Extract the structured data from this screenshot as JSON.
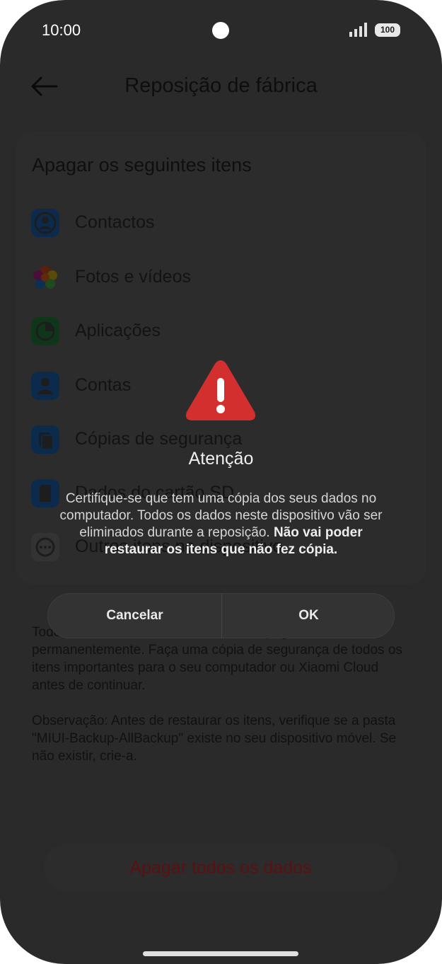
{
  "status_bar": {
    "time": "10:00",
    "battery": "100"
  },
  "header": {
    "title": "Reposição de fábrica"
  },
  "section": {
    "title": "Apagar os seguintes itens",
    "items": [
      {
        "label": "Contactos",
        "icon": "contact-icon",
        "color": "#1e88e5"
      },
      {
        "label": "Fotos e vídeos",
        "icon": "photos-icon",
        "color": "#f4511e"
      },
      {
        "label": "Aplicações",
        "icon": "apps-icon",
        "color": "#43a047"
      },
      {
        "label": "Contas",
        "icon": "account-icon",
        "color": "#1e88e5"
      },
      {
        "label": "Cópias de segurança",
        "icon": "backup-icon",
        "color": "#1e88e5"
      },
      {
        "label": "Dados do cartão SD",
        "icon": "sd-card-icon",
        "color": "#1e88e5"
      },
      {
        "label": "Outros itens no dispositivo",
        "icon": "more-icon",
        "color": "#9e9e9e"
      }
    ]
  },
  "notes": {
    "note1": "Todos os itens listados acima vão ser apagados permanentemente. Faça uma cópia de segurança de todos os itens importantes para o seu computador ou Xiaomi Cloud antes de continuar.",
    "note2": "Observação: Antes de restaurar os itens, verifique se a pasta \"MIUI-Backup-AllBackup\" existe no seu dispositivo móvel. Se não existir, crie-a."
  },
  "erase_button": "Apagar todos os dados",
  "dialog": {
    "title": "Atenção",
    "message": "Certifique-se que tem uma cópia dos seus dados no computador. Todos os dados neste dispositivo vão ser eliminados durante a reposição.",
    "message_bold": "Não vai poder restaurar os itens que não fez cópia.",
    "cancel": "Cancelar",
    "ok": "OK"
  },
  "colors": {
    "overlay": "#2a2a2a",
    "warning": "#d32f2f",
    "erase_text": "#5e1010"
  }
}
